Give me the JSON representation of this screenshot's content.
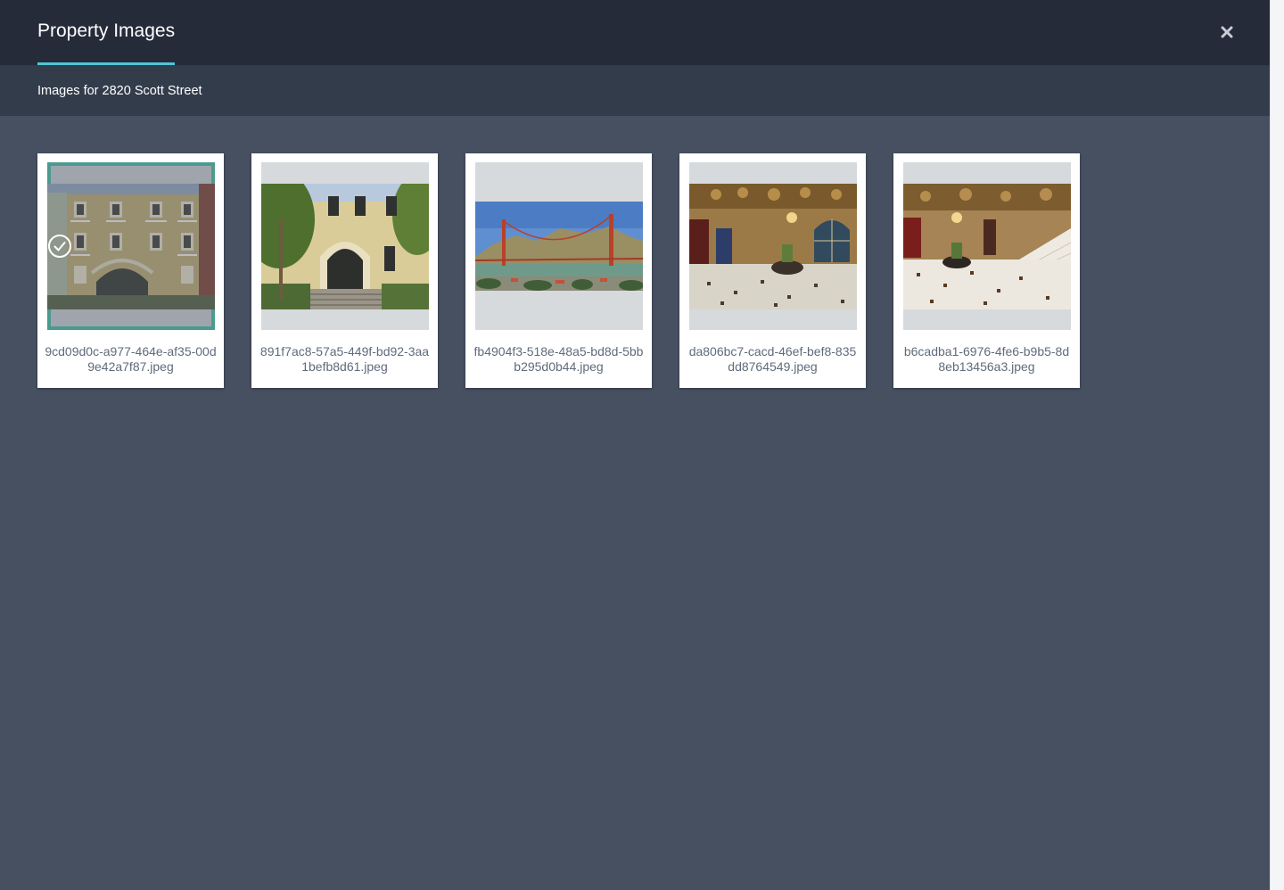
{
  "modal": {
    "title": "Property Images",
    "subtitle": "Images for 2820 Scott Street",
    "close_icon": "close-icon"
  },
  "colors": {
    "header_bg": "#262b39",
    "subheader_bg": "#333c4b",
    "body_bg": "#465061",
    "accent_underline": "#4ec6d8",
    "selected_border": "#4ec8ab"
  },
  "images": [
    {
      "filename": "9cd09d0c-a977-464e-af35-00d9e42a7f87.jpeg",
      "selected": true,
      "icon": "check-circle-icon"
    },
    {
      "filename": "891f7ac8-57a5-449f-bd92-3aa1befb8d61.jpeg",
      "selected": false
    },
    {
      "filename": "fb4904f3-518e-48a5-bd8d-5bbb295d0b44.jpeg",
      "selected": false
    },
    {
      "filename": "da806bc7-cacd-46ef-bef8-835dd8764549.jpeg",
      "selected": false
    },
    {
      "filename": "b6cadba1-6976-4fe6-b9b5-8d8eb13456a3.jpeg",
      "selected": false
    }
  ]
}
